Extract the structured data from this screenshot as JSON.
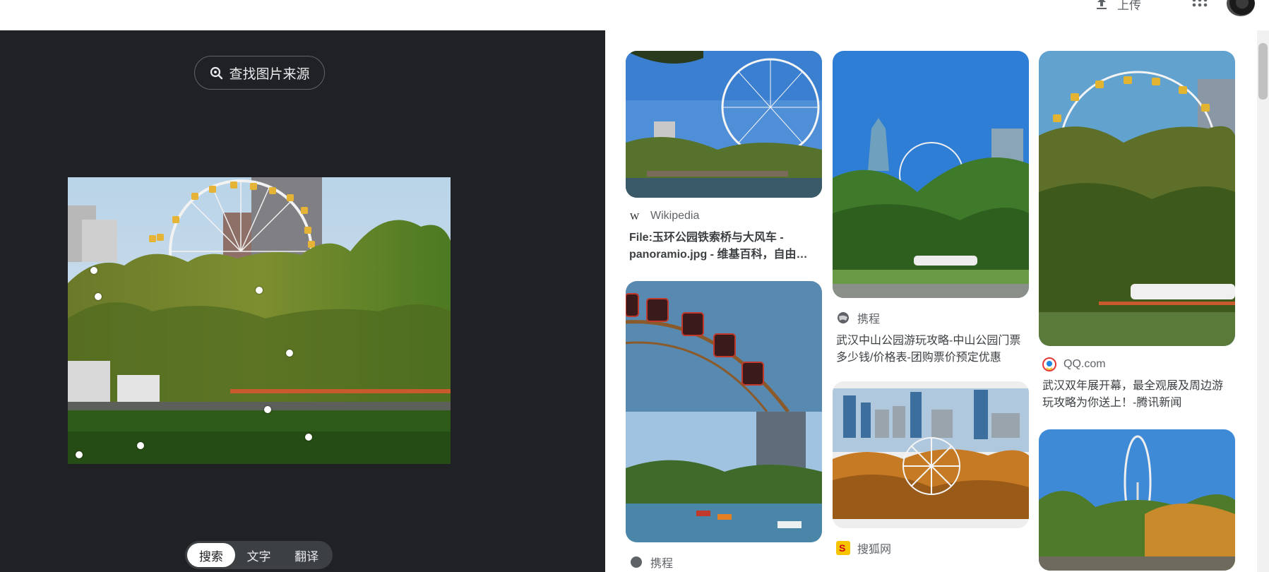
{
  "header": {
    "upload_label": "上传",
    "apps_icon": "apps-grid-icon",
    "avatar": "user-avatar"
  },
  "left_panel": {
    "find_source_label": "查找图片来源",
    "mode_tabs": [
      "搜索",
      "文字",
      "翻译"
    ],
    "active_tab": "搜索"
  },
  "results": [
    {
      "source": "Wikipedia",
      "title": "File:玉环公园铁索桥与大风车 - panoramio.jpg - 维基百科，自由的百科全书"
    },
    {
      "source": "携程",
      "title": ""
    },
    {
      "source": "携程",
      "title": "武汉中山公园游玩攻略-中山公园门票多少钱/价格表-团购票价预定优惠"
    },
    {
      "source": "搜狐网",
      "title": ""
    },
    {
      "source": "QQ.com",
      "title": "武汉双年展开幕，最全观展及周边游玩攻略为你送上！-腾讯新闻"
    }
  ],
  "colors": {
    "dark_panel": "#202124",
    "tab_bg": "#3c4043",
    "text_dark": "#3c4043",
    "text_muted": "#5f6368"
  }
}
